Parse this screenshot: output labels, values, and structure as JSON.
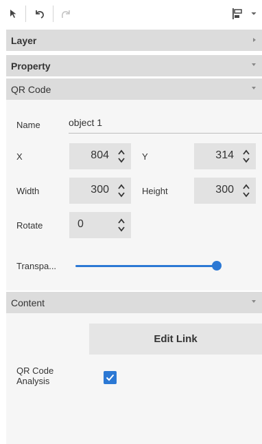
{
  "toolbar": {
    "tools": [
      {
        "name": "select-tool",
        "icon": "cursor-arrow-icon"
      },
      {
        "name": "undo",
        "icon": "undo-icon"
      },
      {
        "name": "redo",
        "icon": "redo-icon",
        "disabled": true
      },
      {
        "name": "align",
        "icon": "align-left-icon"
      }
    ]
  },
  "sections": {
    "layer": "Layer",
    "property": "Property",
    "qr_code": "QR Code",
    "content": "Content"
  },
  "properties": {
    "name_label": "Name",
    "name_value": "object 1",
    "x_label": "X",
    "x_value": "804",
    "y_label": "Y",
    "y_value": "314",
    "width_label": "Width",
    "width_value": "300",
    "height_label": "Height",
    "height_value": "300",
    "rotate_label": "Rotate",
    "rotate_value": "0",
    "transparency_label": "Transpa...",
    "transparency_level_percent": 100
  },
  "content": {
    "edit_link_label": "Edit Link",
    "qr_analysis_label_line1": "QR Code",
    "qr_analysis_label_line2": "Analysis",
    "qr_analysis_checked": true
  },
  "colors": {
    "accent": "#2b78d4",
    "section_header_bg": "#dcdcdc",
    "panel_bg": "#f6f6f6",
    "input_bg": "#e2e2e2"
  }
}
